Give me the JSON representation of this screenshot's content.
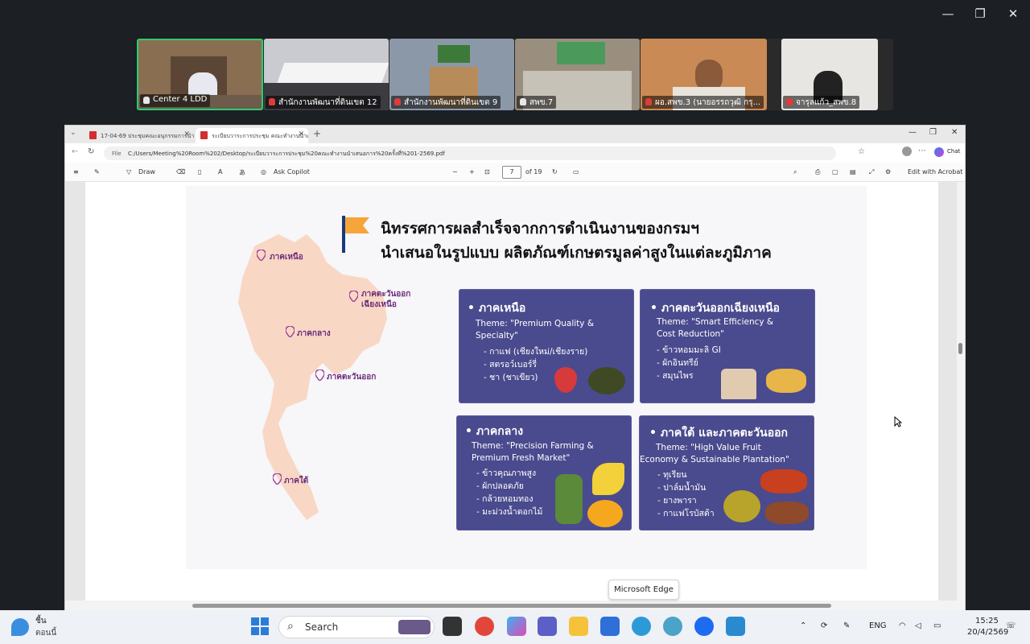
{
  "zoom_window": {
    "controls": [
      "—",
      "❐",
      "✕"
    ]
  },
  "participants": [
    {
      "name": "Center 4 LDD",
      "muted": false
    },
    {
      "name": "สำนักงานพัฒนาที่ดินเขต 12",
      "muted": true
    },
    {
      "name": "สำนักงานพัฒนาที่ดินเขต 9",
      "muted": true
    },
    {
      "name": "สพข.7",
      "muted": false
    },
    {
      "name": "ผอ.สพข.3 (นายอรรถวุฒิ กรุ...",
      "muted": true
    },
    {
      "name": "จารุลแก้ว_สพข.8",
      "muted": true
    }
  ],
  "browser": {
    "tabs": [
      {
        "label": "17-04-69 ประชุมคณะอนุกรรมการนำเสน...",
        "active": false
      },
      {
        "label": "ระเบียบวาระการประชุม คณะทำงานนำเสน...",
        "active": true
      }
    ],
    "address": "C:/Users/Meeting%20Room%202/Desktop/ระเบียบวาระการประชุม%20คณะทำงานนำเสนอการ%20ครั้งที่%201-2569.pdf",
    "file_label": "File",
    "chat_label": "Chat",
    "pdf_toolbar": {
      "draw": "Draw",
      "ask_copilot": "Ask Copilot",
      "page_current": "7",
      "page_total": "of 19",
      "edit_acrobat": "Edit with Acrobat"
    }
  },
  "slide": {
    "title_line1": "นิทรรศการผลสำเร็จจากการดำเนินงานของกรมฯ",
    "title_line2": "นำเสนอในรูปแบบ ผลิตภัณฑ์เกษตรมูลค่าสูงในแต่ละภูมิภาค",
    "map_labels": {
      "north": "ภาคเหนือ",
      "northeast_1": "ภาคตะวันออก",
      "northeast_2": "เฉียงเหนือ",
      "central": "ภาคกลาง",
      "east": "ภาคตะวันออก",
      "south": "ภาคใต้"
    },
    "cards": [
      {
        "heading": "• ภาคเหนือ",
        "theme_1": "Theme: \"Premium Quality &",
        "theme_2": "Specialty\"",
        "items": [
          "- กาแฟ (เชียงใหม่/เชียงราย)",
          "- สตรอว์เบอร์รี่",
          "- ชา (ชาเขียว)"
        ]
      },
      {
        "heading": "• ภาคตะวันออกเฉียงเหนือ",
        "theme_1": "Theme: \"Smart Efficiency &",
        "theme_2": "Cost Reduction\"",
        "items": [
          "- ข้าวหอมมะลิ GI",
          "- ผักอินทรีย์",
          "- สมุนไพร"
        ]
      },
      {
        "heading": "• ภาคกลาง",
        "theme_1": "Theme: \"Precision Farming &",
        "theme_2": "Premium Fresh Market\"",
        "items": [
          "- ข้าวคุณภาพสูง",
          "- ผักปลอดภัย",
          "- กล้วยหอมทอง",
          "- มะม่วงน้ำดอกไม้"
        ]
      },
      {
        "heading": "• ภาคใต้ และภาคตะวันออก",
        "theme_1": "Theme: \"High Value Fruit",
        "theme_2": "Economy & Sustainable Plantation\"",
        "items": [
          "- ทุเรียน",
          "- ปาล์มน้ำมัน",
          "- ยางพารา",
          "- กาแฟโรบัสต้า"
        ]
      }
    ]
  },
  "tooltip": "Microsoft Edge",
  "taskbar": {
    "weather_1": "ชื้น",
    "weather_2": "ตอนนี้",
    "search_placeholder": "Search",
    "lang": "ENG",
    "time": "15:25",
    "date": "20/4/2569"
  },
  "colors": {
    "card_bg": "#4a4a8e",
    "map_fill": "#f9d7c5",
    "pin": "#a0459a",
    "active_speaker": "#2ecc71"
  }
}
